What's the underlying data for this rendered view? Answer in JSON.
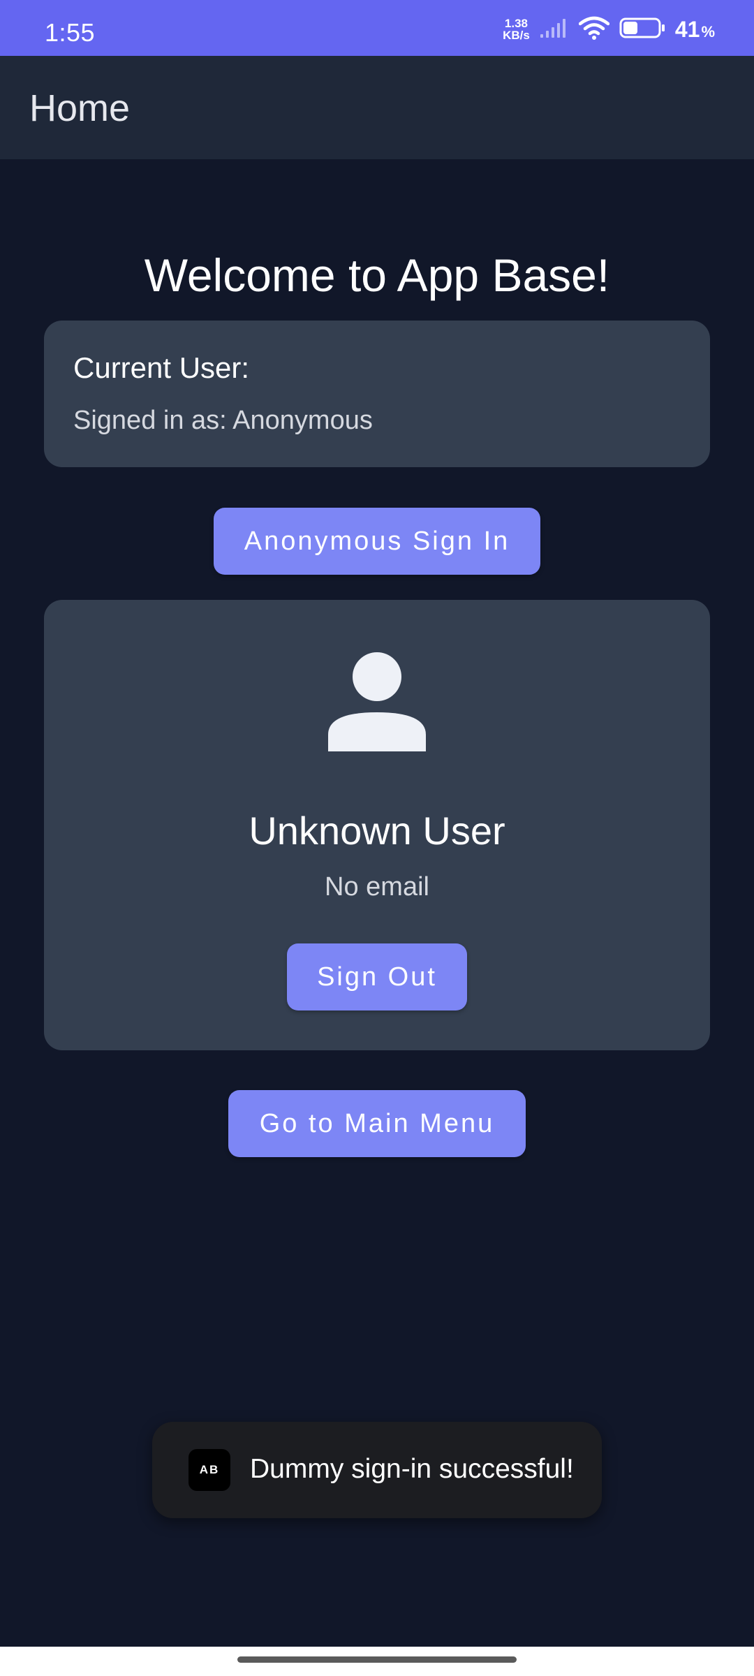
{
  "status_bar": {
    "time": "1:55",
    "net_speed_value": "1.38",
    "net_speed_unit": "KB/s",
    "battery_percent": "41",
    "battery_unit": "%",
    "battery_level": 0.41,
    "icons": [
      "signal-icon",
      "wifi-icon",
      "battery-icon"
    ]
  },
  "app_bar": {
    "title": "Home"
  },
  "welcome": {
    "text": "Welcome to App Base!"
  },
  "current_user": {
    "heading": "Current User:",
    "status": "Signed in as: Anonymous"
  },
  "anonymous_sign_in": {
    "label": "Anonymous Sign In"
  },
  "profile": {
    "icon": "person-icon",
    "name": "Unknown User",
    "email": "No email",
    "sign_out_label": "Sign Out"
  },
  "main_menu": {
    "label": "Go to Main Menu"
  },
  "toast": {
    "logo_text": "AB",
    "message": "Dummy sign-in successful!"
  },
  "colors": {
    "status_bar": "#6466f1",
    "app_bar": "#1f2839",
    "background": "#111729",
    "card": "#343f50",
    "button": "#7d86f5",
    "toast": "#1c1d21"
  }
}
